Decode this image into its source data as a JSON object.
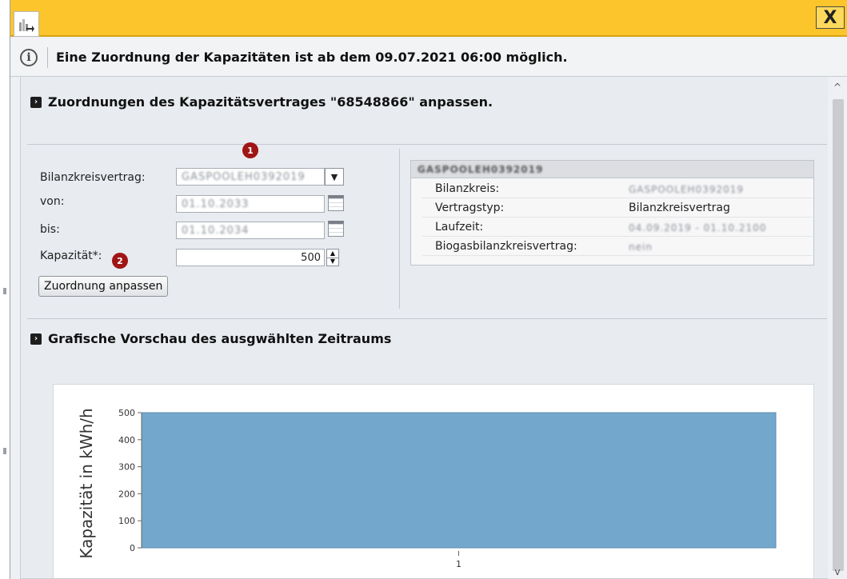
{
  "titlebar": {
    "close_label": "X"
  },
  "info": {
    "message": "Eine Zuordnung der Kapazitäten ist ab dem 09.07.2021 06:00 möglich."
  },
  "section1": {
    "title": "Zuordnungen des Kapazitätsvertrages \"68548866\" anpassen."
  },
  "form": {
    "bilanzkreisvertrag_label": "Bilanzkreisvertrag:",
    "bilanzkreisvertrag_value": "GASPOOLEH0392019",
    "von_label": "von:",
    "von_value": "01.10.2033",
    "bis_label": "bis:",
    "bis_value": "01.10.2034",
    "kapazitaet_label": "Kapazität*:",
    "kapazitaet_value": "500",
    "submit_label": "Zuordnung anpassen",
    "marker1": "1",
    "marker2": "2"
  },
  "details": {
    "header": "GASPOOLEH0392019",
    "rows": [
      {
        "key": "Bilanzkreis:",
        "value": "GASPOOLEH0392019"
      },
      {
        "key": "Vertragstyp:",
        "value": "Bilanzkreisvertrag"
      },
      {
        "key": "Laufzeit:",
        "value": "04.09.2019 - 01.10.2100"
      },
      {
        "key": "Biogasbilanzkreisvertrag:",
        "value": "nein"
      }
    ]
  },
  "section2": {
    "title": "Grafische Vorschau des ausgwählten Zeitraums"
  },
  "chart_data": {
    "type": "bar",
    "categories": [
      "1"
    ],
    "values": [
      500
    ],
    "ylabel": "Kapazität in kWh/h",
    "xlabel": "",
    "ylim": [
      0,
      500
    ],
    "yticks": [
      0,
      100,
      200,
      300,
      400,
      500
    ],
    "bar_color": "#74a7cc",
    "grid": false
  },
  "colors": {
    "titlebar": "#fbc52b",
    "marker": "#a01515",
    "bar": "#74a7cc"
  }
}
